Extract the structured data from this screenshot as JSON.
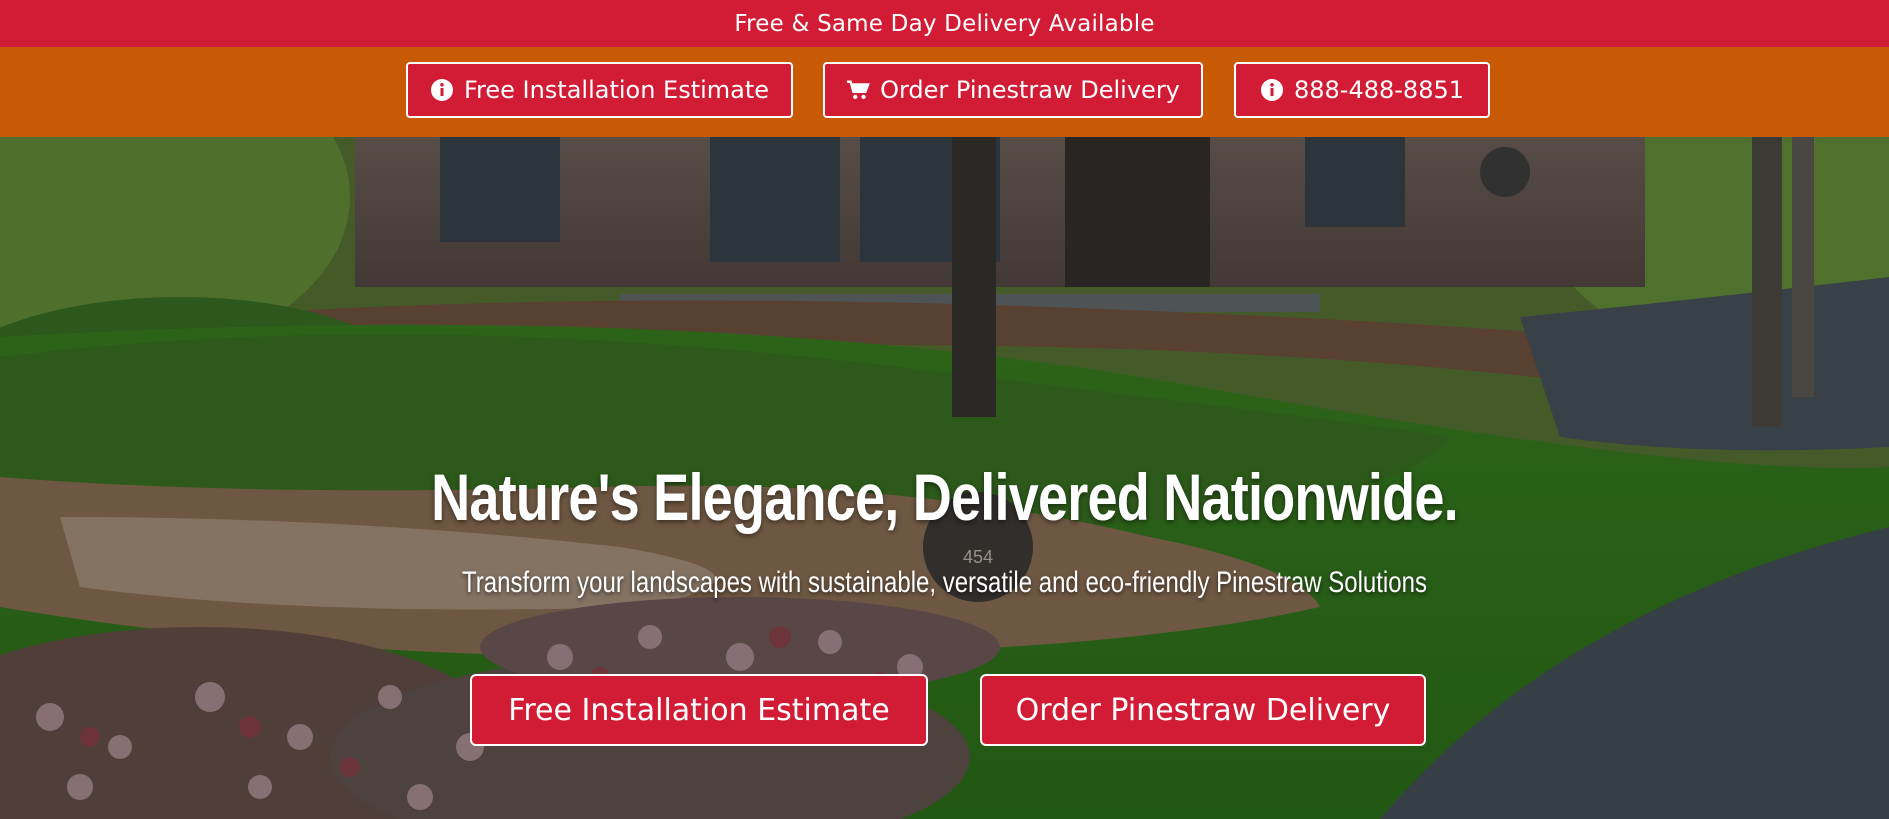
{
  "announcement": {
    "text": "Free & Same Day Delivery Available"
  },
  "nav": {
    "estimate_label": "Free Installation Estimate",
    "order_label": "Order Pinestraw Delivery",
    "phone_label": "888-488-8851"
  },
  "hero": {
    "title": "Nature's Elegance, Delivered Nationwide.",
    "subtitle": "Transform your landscapes with sustainable, versatile and eco-friendly Pinestraw Solutions",
    "cta_estimate_label": "Free Installation Estimate",
    "cta_order_label": "Order Pinestraw Delivery",
    "address_sign": "454"
  },
  "icons": {
    "estimate": "info-icon",
    "order": "cart-icon",
    "phone": "info-icon"
  },
  "colors": {
    "brand_red": "#d21c35",
    "action_orange": "#c85a05",
    "text": "#ffffff"
  }
}
